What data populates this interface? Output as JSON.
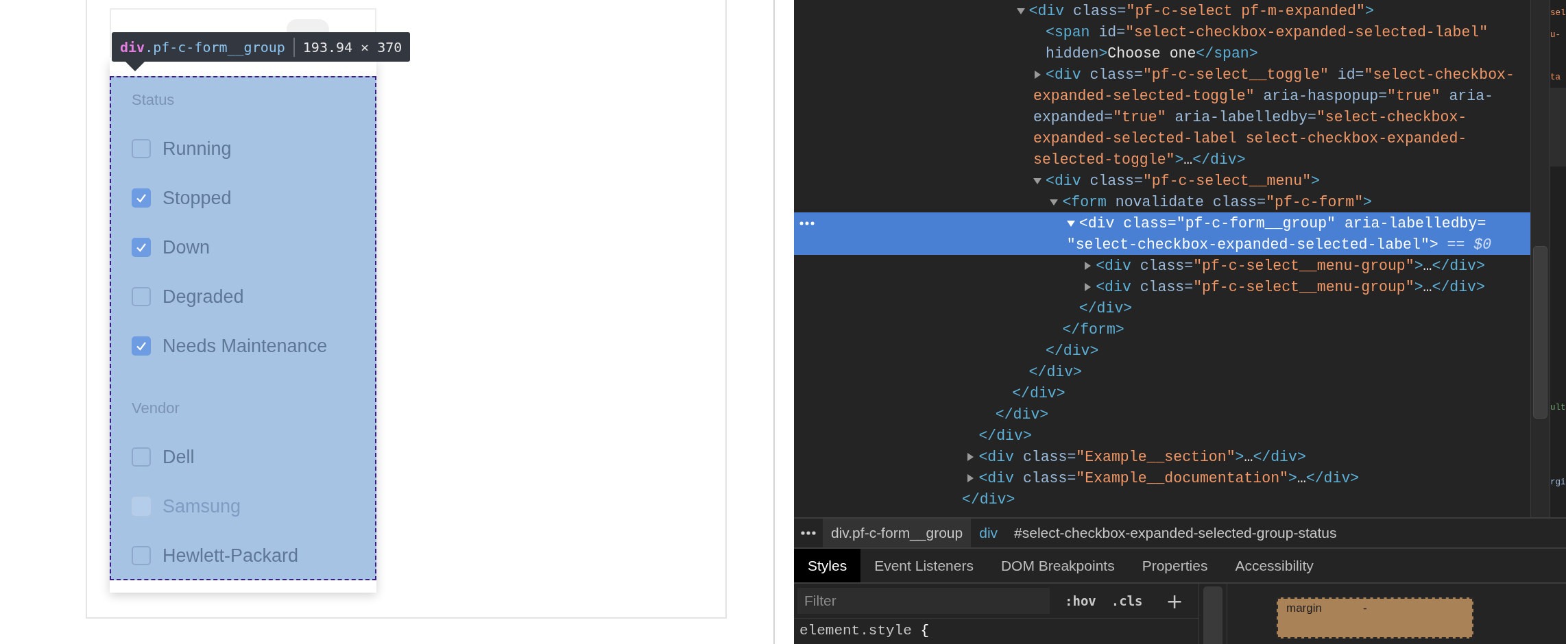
{
  "page": {
    "select": {
      "badge_shown": true,
      "groups": [
        {
          "title": "Status",
          "options": [
            {
              "label": "Running",
              "checked": false,
              "disabled": false
            },
            {
              "label": "Stopped",
              "checked": true,
              "disabled": false
            },
            {
              "label": "Down",
              "checked": true,
              "disabled": false
            },
            {
              "label": "Degraded",
              "checked": false,
              "disabled": false
            },
            {
              "label": "Needs Maintenance",
              "checked": true,
              "disabled": false
            }
          ]
        },
        {
          "title": "Vendor",
          "options": [
            {
              "label": "Dell",
              "checked": false,
              "disabled": false
            },
            {
              "label": "Samsung",
              "checked": false,
              "disabled": true
            },
            {
              "label": "Hewlett-Packard",
              "checked": false,
              "disabled": false
            }
          ]
        }
      ]
    },
    "inspect_tooltip": {
      "tag": "div",
      "class_name": ".pf-c-form__group",
      "size": "193.94 × 370"
    }
  },
  "devtools": {
    "dom_tree": [
      {
        "close": [
          {
            "kind": "tag",
            "text": "</div>"
          }
        ],
        "children": [
          {
            "close": [
              {
                "kind": "tag",
                "text": "</div>"
              }
            ],
            "children": [
              {
                "close": [
                  {
                    "kind": "tag",
                    "text": "</div>"
                  }
                ],
                "children": [
                  {
                    "close": [
                      {
                        "kind": "tag",
                        "text": "</div>"
                      }
                    ],
                    "children": [
                      {
                        "open": [
                          [
                            {
                              "kind": "tag",
                              "text": "<div"
                            },
                            {
                              "kind": "attr",
                              "text": " class="
                            },
                            {
                              "kind": "value",
                              "text": "\"pf-c-select pf-m-expanded\""
                            },
                            {
                              "kind": "tag",
                              "text": ">"
                            }
                          ]
                        ],
                        "expanded": true,
                        "selected": false,
                        "close": [
                          {
                            "kind": "tag",
                            "text": "</div>"
                          }
                        ],
                        "children": [
                          {
                            "open": [
                              [
                                {
                                  "kind": "tag",
                                  "text": "<span"
                                },
                                {
                                  "kind": "attr",
                                  "text": " id="
                                },
                                {
                                  "kind": "value",
                                  "text": "\"select-checkbox-expanded-selected-label\""
                                }
                              ],
                              [
                                {
                                  "kind": "attr",
                                  "text": "hidden"
                                },
                                {
                                  "kind": "tag",
                                  "text": ">"
                                },
                                {
                                  "kind": "text",
                                  "text": "Choose one"
                                },
                                {
                                  "kind": "tag",
                                  "text": "</span>"
                                }
                              ]
                            ],
                            "selected": false
                          },
                          {
                            "open": [
                              [
                                {
                                  "kind": "tag",
                                  "text": "<div"
                                },
                                {
                                  "kind": "attr",
                                  "text": " class="
                                },
                                {
                                  "kind": "value",
                                  "text": "\"pf-c-select__toggle\""
                                },
                                {
                                  "kind": "attr",
                                  "text": " id="
                                },
                                {
                                  "kind": "value",
                                  "text": "\"select-checkbox-"
                                }
                              ],
                              [
                                {
                                  "kind": "value",
                                  "text": "expanded-selected-toggle\""
                                },
                                {
                                  "kind": "attr",
                                  "text": " aria-haspopup="
                                },
                                {
                                  "kind": "value",
                                  "text": "\"true\""
                                },
                                {
                                  "kind": "attr",
                                  "text": " aria-"
                                }
                              ],
                              [
                                {
                                  "kind": "attr",
                                  "text": "expanded="
                                },
                                {
                                  "kind": "value",
                                  "text": "\"true\""
                                },
                                {
                                  "kind": "attr",
                                  "text": " aria-labelledby="
                                },
                                {
                                  "kind": "value",
                                  "text": "\"select-checkbox-"
                                }
                              ],
                              [
                                {
                                  "kind": "value",
                                  "text": "expanded-selected-label select-checkbox-expanded-"
                                }
                              ],
                              [
                                {
                                  "kind": "value",
                                  "text": "selected-toggle\""
                                },
                                {
                                  "kind": "tag",
                                  "text": ">"
                                },
                                {
                                  "kind": "text",
                                  "text": "…"
                                },
                                {
                                  "kind": "tag",
                                  "text": "</div>"
                                }
                              ]
                            ],
                            "expanded": false,
                            "selected": false
                          },
                          {
                            "open": [
                              [
                                {
                                  "kind": "tag",
                                  "text": "<div"
                                },
                                {
                                  "kind": "attr",
                                  "text": " class="
                                },
                                {
                                  "kind": "value",
                                  "text": "\"pf-c-select__menu\""
                                },
                                {
                                  "kind": "tag",
                                  "text": ">"
                                }
                              ]
                            ],
                            "expanded": true,
                            "selected": false,
                            "close": [
                              {
                                "kind": "tag",
                                "text": "</div>"
                              }
                            ],
                            "children": [
                              {
                                "open": [
                                  [
                                    {
                                      "kind": "tag",
                                      "text": "<form"
                                    },
                                    {
                                      "kind": "attr",
                                      "text": " novalidate class="
                                    },
                                    {
                                      "kind": "value",
                                      "text": "\"pf-c-form\""
                                    },
                                    {
                                      "kind": "tag",
                                      "text": ">"
                                    }
                                  ]
                                ],
                                "expanded": true,
                                "selected": false,
                                "close": [
                                  {
                                    "kind": "tag",
                                    "text": "</form>"
                                  }
                                ],
                                "children": [
                                  {
                                    "open": [
                                      [
                                        {
                                          "kind": "tag",
                                          "text": "<div"
                                        },
                                        {
                                          "kind": "attr",
                                          "text": " class="
                                        },
                                        {
                                          "kind": "value",
                                          "text": "\"pf-c-form__group\""
                                        },
                                        {
                                          "kind": "attr",
                                          "text": " aria-labelledby="
                                        }
                                      ],
                                      [
                                        {
                                          "kind": "value",
                                          "text": "\"select-checkbox-expanded-selected-label\""
                                        },
                                        {
                                          "kind": "tag",
                                          "text": ">"
                                        },
                                        {
                                          "kind": "hint",
                                          "text": " == $0"
                                        }
                                      ]
                                    ],
                                    "expanded": true,
                                    "selected": true,
                                    "close": [
                                      {
                                        "kind": "tag",
                                        "text": "</div>"
                                      }
                                    ],
                                    "children": [
                                      {
                                        "open": [
                                          [
                                            {
                                              "kind": "tag",
                                              "text": "<div"
                                            },
                                            {
                                              "kind": "attr",
                                              "text": " class="
                                            },
                                            {
                                              "kind": "value",
                                              "text": "\"pf-c-select__menu-group\""
                                            },
                                            {
                                              "kind": "tag",
                                              "text": ">"
                                            },
                                            {
                                              "kind": "text",
                                              "text": "…"
                                            },
                                            {
                                              "kind": "tag",
                                              "text": "</div>"
                                            }
                                          ]
                                        ],
                                        "expanded": false,
                                        "selected": false
                                      },
                                      {
                                        "open": [
                                          [
                                            {
                                              "kind": "tag",
                                              "text": "<div"
                                            },
                                            {
                                              "kind": "attr",
                                              "text": " class="
                                            },
                                            {
                                              "kind": "value",
                                              "text": "\"pf-c-select__menu-group\""
                                            },
                                            {
                                              "kind": "tag",
                                              "text": ">"
                                            },
                                            {
                                              "kind": "text",
                                              "text": "…"
                                            },
                                            {
                                              "kind": "tag",
                                              "text": "</div>"
                                            }
                                          ]
                                        ],
                                        "expanded": false,
                                        "selected": false
                                      }
                                    ]
                                  }
                                ]
                              }
                            ]
                          }
                        ]
                      }
                    ]
                  }
                ]
              }
            ]
          },
          {
            "open": [
              [
                {
                  "kind": "tag",
                  "text": "<div"
                },
                {
                  "kind": "attr",
                  "text": " class="
                },
                {
                  "kind": "value",
                  "text": "\"Example__section\""
                },
                {
                  "kind": "tag",
                  "text": ">"
                },
                {
                  "kind": "text",
                  "text": "…"
                },
                {
                  "kind": "tag",
                  "text": "</div>"
                }
              ]
            ],
            "expanded": false,
            "selected": false
          },
          {
            "open": [
              [
                {
                  "kind": "tag",
                  "text": "<div"
                },
                {
                  "kind": "attr",
                  "text": " class="
                },
                {
                  "kind": "value",
                  "text": "\"Example__documentation\""
                },
                {
                  "kind": "tag",
                  "text": ">"
                },
                {
                  "kind": "text",
                  "text": "…"
                },
                {
                  "kind": "tag",
                  "text": "</div>"
                }
              ]
            ],
            "expanded": false,
            "selected": false
          }
        ]
      }
    ],
    "side_fragments": [
      {
        "text": "sel",
        "kind": "value"
      },
      {
        "text": "u-",
        "kind": "value"
      },
      {
        "text": "ta",
        "kind": "value"
      },
      {
        "text": "ult",
        "kind": "comment"
      },
      {
        "text": "rgi",
        "kind": "attr"
      }
    ],
    "breadcrumbs": [
      {
        "text": "div.pf-c-form__group",
        "kind": "class",
        "selected": true
      },
      {
        "text": "div",
        "kind": "tag",
        "selected": false
      },
      {
        "text": "#select-checkbox-expanded-selected-group-status",
        "kind": "id",
        "selected": false
      }
    ],
    "tabs": [
      {
        "label": "Styles",
        "selected": true
      },
      {
        "label": "Event Listeners",
        "selected": false
      },
      {
        "label": "DOM Breakpoints",
        "selected": false
      },
      {
        "label": "Properties",
        "selected": false
      },
      {
        "label": "Accessibility",
        "selected": false
      }
    ],
    "styles_filter": {
      "placeholder": "Filter"
    },
    "style_buttons": [
      ":hov",
      ".cls",
      "+"
    ],
    "rules": [
      {
        "selector": "element.style",
        "brace": "{"
      }
    ],
    "box_model": {
      "label": "margin",
      "value": "-"
    }
  }
}
